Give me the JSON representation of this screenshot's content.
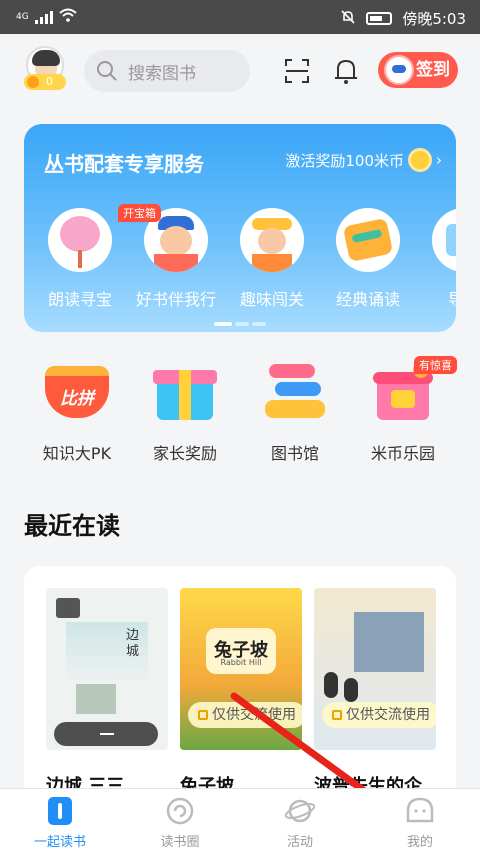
{
  "status_bar": {
    "network": "4G",
    "time": "傍晚5:03"
  },
  "header": {
    "coins": "0",
    "search_placeholder": "搜索图书",
    "signin_label": "签到"
  },
  "banner": {
    "title": "丛书配套专享服务",
    "reward_text": "激活奖励100米币",
    "badge": "开宝箱",
    "services": [
      {
        "label": "朗读寻宝"
      },
      {
        "label": "好书伴我行"
      },
      {
        "label": "趣味闯关"
      },
      {
        "label": "经典诵读"
      },
      {
        "label": "导读"
      }
    ]
  },
  "quick_menu": {
    "items": [
      {
        "label": "知识大PK",
        "icon_text": "比拼"
      },
      {
        "label": "家长奖励"
      },
      {
        "label": "图书馆"
      },
      {
        "label": "米币乐园"
      }
    ],
    "surprise_badge": "有惊喜"
  },
  "recent": {
    "title": "最近在读",
    "books": [
      {
        "title": "边城 三三",
        "cover_text": "边城"
      },
      {
        "title": "兔子坡",
        "cover_text": "兔子坡",
        "cover_subtext": "Rabbit Hill",
        "notice": "仅供交流使用"
      },
      {
        "title": "波普先生的企",
        "notice": "仅供交流使用"
      }
    ]
  },
  "tabbar": {
    "tabs": [
      {
        "label": "一起读书"
      },
      {
        "label": "读书圈"
      },
      {
        "label": "活动"
      },
      {
        "label": "我的"
      }
    ]
  },
  "colors": {
    "accent": "#1f8ff7",
    "banner": "#3aa6f7",
    "signin": "#ff5a4e",
    "annotation_arrow": "#e8231a"
  }
}
